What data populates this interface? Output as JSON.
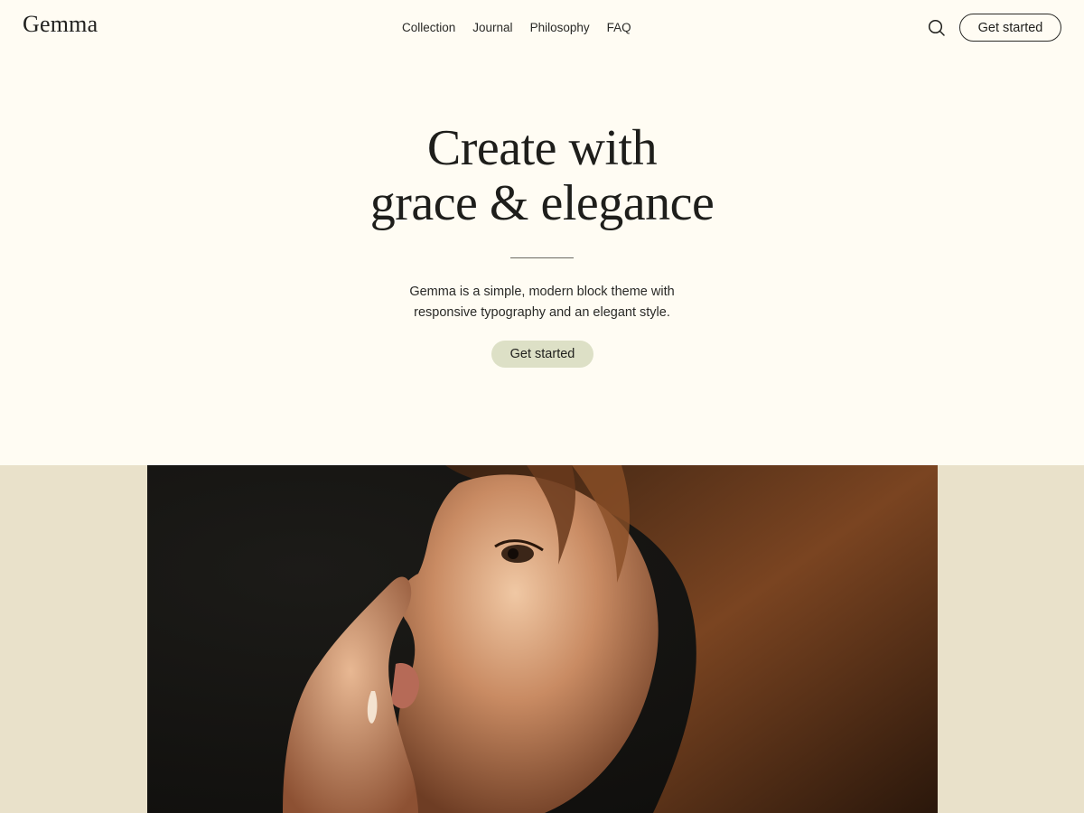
{
  "site": {
    "logo": "Gemma"
  },
  "nav": {
    "items": [
      {
        "label": "Collection"
      },
      {
        "label": "Journal"
      },
      {
        "label": "Philosophy"
      },
      {
        "label": "FAQ"
      }
    ]
  },
  "header": {
    "search_icon": "search-icon",
    "cta_label": "Get started"
  },
  "hero": {
    "title_line1": "Create with",
    "title_line2": "grace & elegance",
    "description_line1": "Gemma is a simple, modern block theme with",
    "description_line2": "responsive typography and an elegant style.",
    "cta_label": "Get started"
  },
  "featured_image": {
    "subject": "portrait-photo"
  },
  "colors": {
    "page_background": "#fffcf3",
    "band_background": "#e9e1ca",
    "button_accent": "#dde0c6",
    "text": "#1f1f1c"
  }
}
